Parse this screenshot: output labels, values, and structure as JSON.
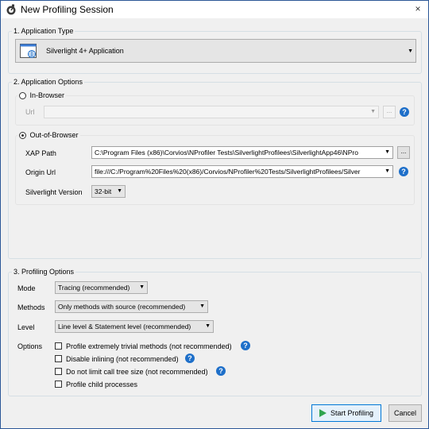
{
  "window": {
    "title": "New Profiling Session",
    "close_glyph": "×"
  },
  "app_type": {
    "group_label": "1. Application Type",
    "selected": "Silverlight 4+ Application"
  },
  "app_options": {
    "group_label": "2. Application Options",
    "in_browser": {
      "radio_label": "In-Browser",
      "url_label": "Url",
      "url_value": "",
      "browse_label": "..."
    },
    "out_of_browser": {
      "radio_label": "Out-of-Browser",
      "xap_label": "XAP Path",
      "xap_value": "C:\\Program Files (x86)\\Corvios\\NProfiler Tests\\SilverlightProfilees\\SilverlightApp46\\NPro",
      "browse_label": "...",
      "origin_label": "Origin Url",
      "origin_value": "file:///C:/Program%20Files%20(x86)/Corvios/NProfiler%20Tests/SilverlightProfilees/Silver",
      "version_label": "Silverlight Version",
      "version_value": "32-bit"
    }
  },
  "profiling_options": {
    "group_label": "3. Profiling Options",
    "mode_label": "Mode",
    "mode_value": "Tracing (recommended)",
    "methods_label": "Methods",
    "methods_value": "Only methods with source (recommended)",
    "level_label": "Level",
    "level_value": "Line level & Statement level (recommended)",
    "options_label": "Options",
    "checkboxes": [
      {
        "label": "Profile extremely trivial methods (not recommended)",
        "checked": false
      },
      {
        "label": "Disable inlining (not recommended)",
        "checked": false
      },
      {
        "label": "Do not limit call tree size (not recommended)",
        "checked": false
      },
      {
        "label": "Profile child processes",
        "checked": false
      }
    ]
  },
  "buttons": {
    "start": "Start Profiling",
    "cancel": "Cancel"
  },
  "help_glyph": "?",
  "colors": {
    "accent": "#0078d7",
    "help": "#1e6fc9",
    "start_icon": "#2ea44f"
  }
}
